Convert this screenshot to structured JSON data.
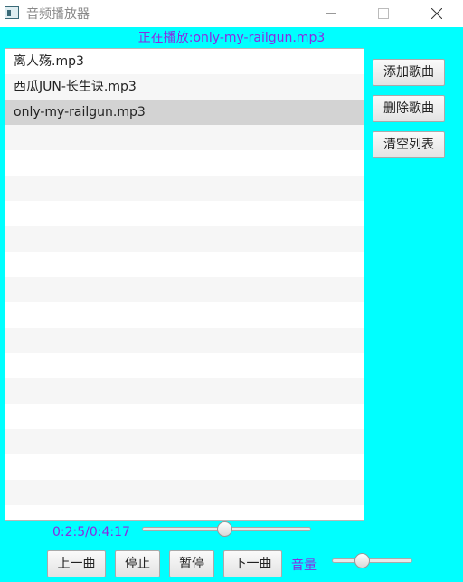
{
  "window": {
    "title": "音频播放器"
  },
  "now_playing": "正在播放:only-my-railgun.mp3",
  "playlist": {
    "items": [
      "离人殇.mp3",
      "西瓜JUN-长生诀.mp3",
      "only-my-railgun.mp3"
    ],
    "selected_index": 2
  },
  "side_buttons": {
    "add": "添加歌曲",
    "delete": "删除歌曲",
    "clear": "清空列表"
  },
  "progress": {
    "time_text": "0:2:5/0:4:17",
    "fraction": 0.49
  },
  "controls": {
    "prev": "上一曲",
    "stop": "停止",
    "pause": "暂停",
    "next": "下一曲"
  },
  "volume": {
    "label": "音量",
    "fraction": 0.35
  },
  "colors": {
    "background": "#00ffff",
    "accent_text": "#8a2be2",
    "selected_row": "#d3d3d3"
  }
}
